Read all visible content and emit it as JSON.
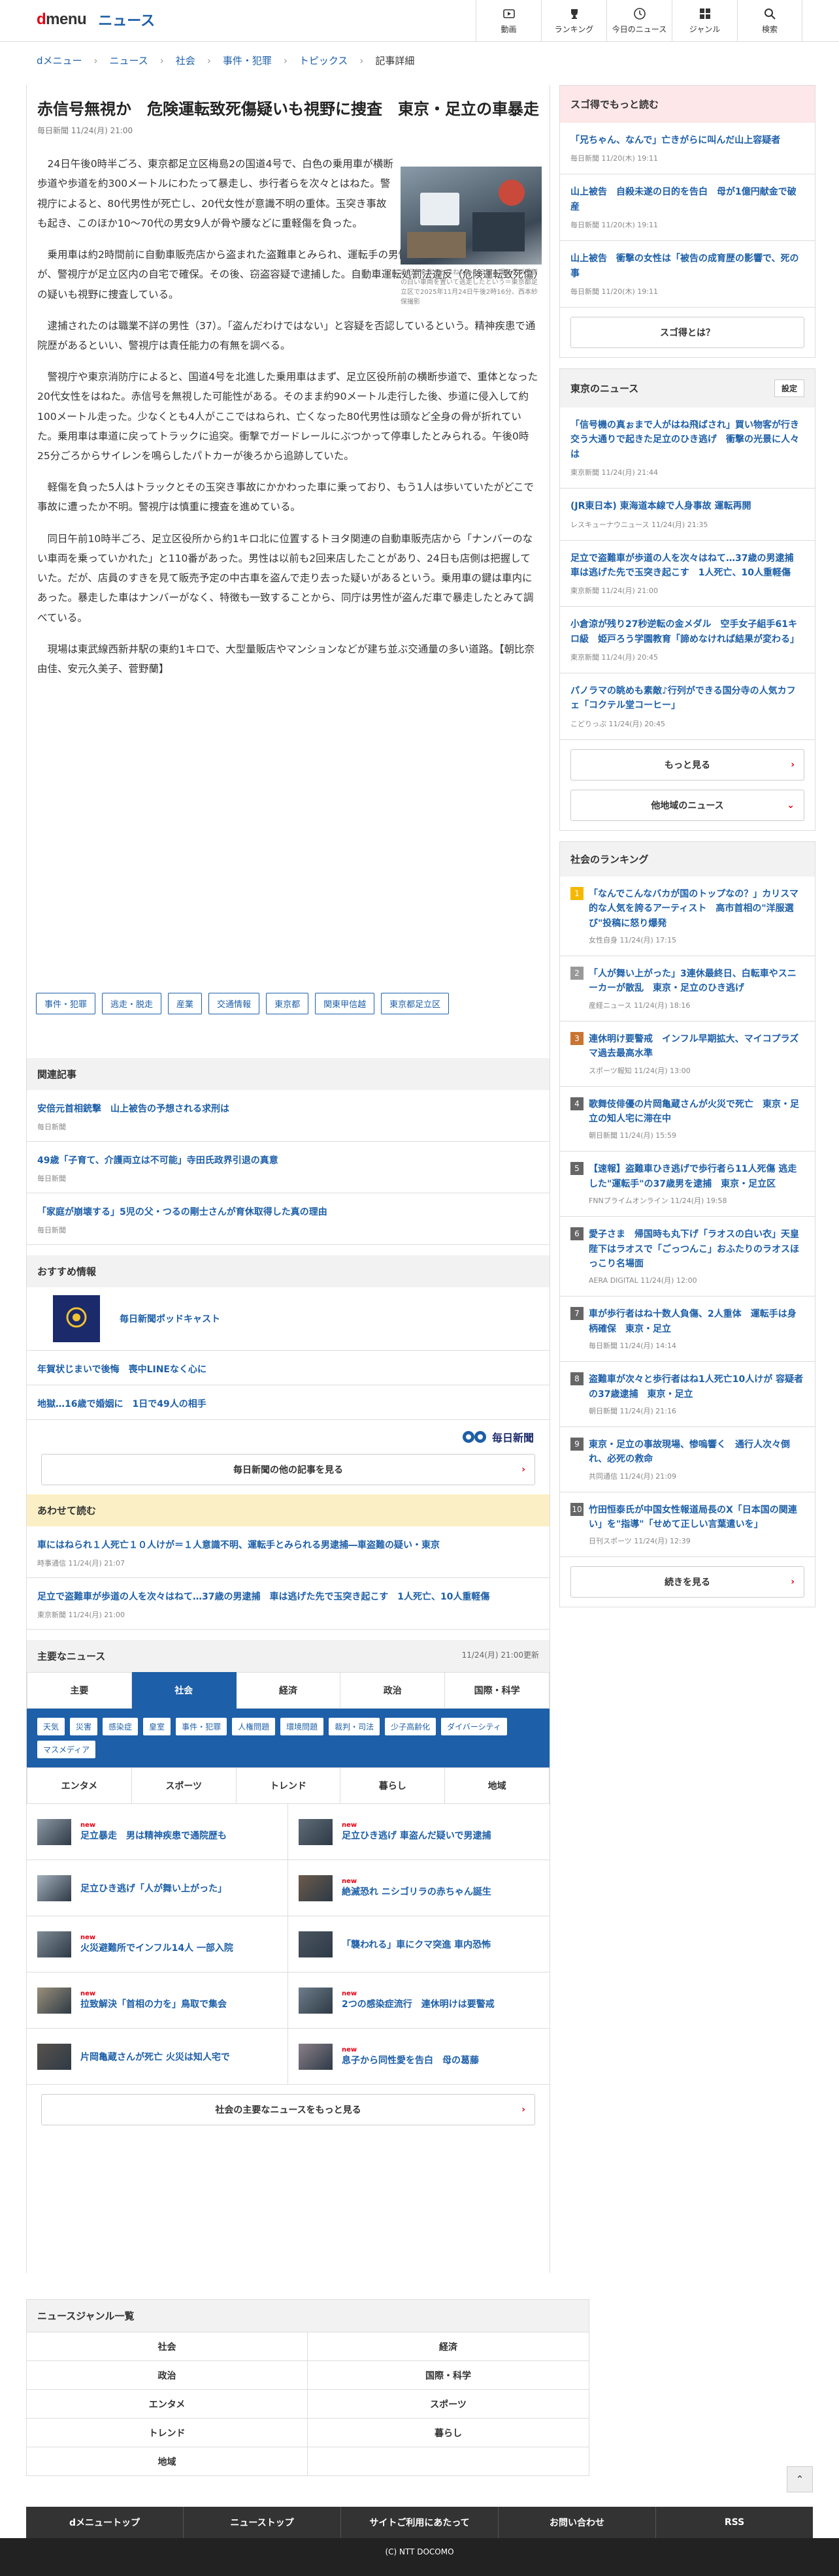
{
  "header": {
    "logo_d": "d",
    "logo_menu": "menu",
    "site": "ニュース",
    "nav": [
      "動画",
      "ランキング",
      "今日のニュース",
      "ジャンル",
      "検索"
    ]
  },
  "breadcrumb": [
    "dメニュー",
    "ニュース",
    "社会",
    "事件・犯罪",
    "トピックス",
    "記事詳細"
  ],
  "article": {
    "title": "赤信号無視か　危険運転致死傷疑いも視野に捜査　東京・足立の車暴走",
    "date": "毎日新聞 11/24(月) 21:00",
    "caption": "歩行者を次々とはねたとみられ、運転手が手前の白い車両を置いて逃走したという＝東京都足立区で2025年11月24日午後2時16分、西本紗保撮影",
    "paragraphs": [
      "24日午後0時半ごろ、東京都足立区梅島2の国道4号で、白色の乗用車が横断歩道や歩道を約300メートルにわたって暴走し、歩行者らを次々とはねた。警視庁によると、80代男性が死亡し、20代女性が意識不明の重体。玉突き事故も起き、このほか10～70代の男女9人が骨や腰などに重軽傷を負った。",
      "乗用車は約2時間前に自動車販売店から盗まれた盗難車とみられ、運転手の男性は徒歩で現場から逃走したが、警視庁が足立区内の自宅で確保。その後、窃盗容疑で逮捕した。自動車運転処罰法違反（危険運転致死傷）の疑いも視野に捜査している。",
      "逮捕されたのは職業不詳の男性（37）。「盗んだわけではない」と容疑を否認しているという。精神疾患で通院歴があるといい、警視庁は責任能力の有無を調べる。",
      "警視庁や東京消防庁によると、国道4号を北進した乗用車はまず、足立区役所前の横断歩道で、重体となった20代女性をはねた。赤信号を無視した可能性がある。そのまま約90メートル走行した後、歩道に侵入して約100メートル走った。少なくとも4人がここではねられ、亡くなった80代男性は頭など全身の骨が折れていた。乗用車は車道に戻ってトラックに追突。衝撃でガードレールにぶつかって停車したとみられる。午後0時25分ごろからサイレンを鳴らしたパトカーが後ろから追跡していた。",
      "軽傷を負った5人はトラックとその玉突き事故にかかわった車に乗っており、もう1人は歩いていたがどこで事故に遭ったか不明。警視庁は慎重に捜査を進めている。",
      "同日午前10時半ごろ、足立区役所から約1キロ北に位置するトヨタ関連の自動車販売店から「ナンバーのない車両を乗っていかれた」と110番があった。男性は以前も2回来店したことがあり、24日も店側は把握していた。だが、店員のすきを見て販売予定の中古車を盗んで走り去った疑いがあるという。乗用車の鍵は車内にあった。暴走した車はナンバーがなく、特徴も一致することから、同庁は男性が盗んだ車で暴走したとみて調べている。",
      "現場は東武線西新井駅の東約1キロで、大型量販店やマンションなどが建ち並ぶ交通量の多い道路。【朝比奈由佳、安元久美子、菅野蘭】"
    ],
    "tags": [
      "事件・犯罪",
      "逃走・脱走",
      "産業",
      "交通情報",
      "東京都",
      "関東甲信越",
      "東京都足立区"
    ]
  },
  "related": {
    "heading": "関連記事",
    "items": [
      {
        "title": "安倍元首相銃撃　山上被告の予想される求刑は",
        "src": "毎日新聞"
      },
      {
        "title": "49歳「子育て、介護両立は不可能」寺田氏政界引退の真意",
        "src": "毎日新聞"
      },
      {
        "title": "「家庭が崩壊する」5児の父・つるの剛士さんが育休取得した真の理由",
        "src": "毎日新聞"
      }
    ]
  },
  "recommend": {
    "heading": "おすすめ情報",
    "podcast": "毎日新聞ポッドキャスト",
    "items": [
      "年賀状じまいで後悔　喪中LINEなく心に",
      "地獄…16歳で婚姻に　1日で49人の相手"
    ],
    "brand": "毎日新聞",
    "more": "毎日新聞の他の記事を見る"
  },
  "also": {
    "heading": "あわせて読む",
    "items": [
      {
        "title": "車にはねられ１人死亡１０人けが＝１人意識不明、運転手とみられる男逮捕―車盗難の疑い・東京",
        "src": "時事通信 11/24(月) 21:07"
      },
      {
        "title": "足立で盗難車が歩道の人を次々はねて…37歳の男逮捕　車は逃げた先で玉突き起こす　1人死亡、10人重軽傷",
        "src": "東京新聞 11/24(月) 21:00"
      }
    ]
  },
  "major": {
    "heading": "主要なニュース",
    "updated": "11/24(月) 21:00更新",
    "tabs1": [
      "主要",
      "社会",
      "経済",
      "政治",
      "国際・科学"
    ],
    "chips": [
      "天気",
      "災害",
      "感染症",
      "皇室",
      "事件・犯罪",
      "人権問題",
      "環境問題",
      "裁判・司法",
      "少子高齢化",
      "ダイバーシティ",
      "マスメディア"
    ],
    "tabs2": [
      "エンタメ",
      "スポーツ",
      "トレンド",
      "暮らし",
      "地域"
    ],
    "new_label": "new",
    "items": [
      {
        "title": "足立暴走　男は精神疾患で通院歴も",
        "new": true
      },
      {
        "title": "足立ひき逃げ 車盗んだ疑いで男逮捕",
        "new": true
      },
      {
        "title": "足立ひき逃げ「人が舞い上がった」",
        "new": false
      },
      {
        "title": "絶滅恐れ ニシゴリラの赤ちゃん誕生",
        "new": true
      },
      {
        "title": "火災避難所でインフル14人 一部入院",
        "new": true
      },
      {
        "title": "「襲われる」車にクマ突進 車内恐怖",
        "new": false
      },
      {
        "title": "拉致解決「首相の力を」鳥取で集会",
        "new": true
      },
      {
        "title": "2つの感染症流行　連休明けは要警戒",
        "new": true
      },
      {
        "title": "片岡亀蔵さんが死亡 火災は知人宅で",
        "new": false
      },
      {
        "title": "息子から同性愛を告白　母の葛藤",
        "new": true
      }
    ],
    "more": "社会の主要なニュースをもっと見る"
  },
  "genre": {
    "heading": "ニュースジャンル一覧",
    "items": [
      "社会",
      "経済",
      "政治",
      "国際・科学",
      "エンタメ",
      "スポーツ",
      "トレンド",
      "暮らし",
      "地域",
      ""
    ]
  },
  "sugotoku": {
    "heading": "スゴ得でもっと読む",
    "items": [
      {
        "title": "「兄ちゃん、なんで」亡きがらに叫んだ山上容疑者",
        "src": "毎日新聞 11/20(木) 19:11"
      },
      {
        "title": "山上被告　自殺未遂の日的を告白　母が1億円献金で破産",
        "src": "毎日新聞 11/20(木) 19:11"
      },
      {
        "title": "山上被告　衝撃の女性は「被告の成育歴の影響で、死の事",
        "src": "毎日新聞 11/20(木) 19:11"
      }
    ],
    "what": "スゴ得とは？"
  },
  "tokyo": {
    "heading": "東京のニュース",
    "setting": "設定",
    "items": [
      {
        "title": "「信号機の真ぉまで人がはね飛ばされ」買い物客が行き交う大通りで起きた足立のひき逃げ　衝撃の光景に人々は",
        "src": "東京新聞 11/24(月) 21:44"
      },
      {
        "title": "(JR東日本) 東海道本線で人身事故 運転再開",
        "src": "レスキューナウニュース 11/24(月) 21:35"
      },
      {
        "title": "足立で盗難車が歩道の人を次々はねて…37歳の男逮捕　車は逃げた先で玉突き起こす　1人死亡、10人重軽傷",
        "src": "東京新聞 11/24(月) 21:00"
      },
      {
        "title": "小倉涼が残り27秒逆転の金メダル　空手女子組手61キロ級　姫戸ろう学園教育「諦めなければ結果が変わる」",
        "src": "東京新聞 11/24(月) 20:45"
      },
      {
        "title": "パノラマの眺めも素敵♪行列ができる国分寺の人気カフェ「コクテル堂コーヒー」",
        "src": "こどりっぷ 11/24(月) 20:45"
      }
    ],
    "more": "もっと見る",
    "region": "他地域のニュース"
  },
  "ranking": {
    "heading": "社会のランキング",
    "items": [
      {
        "title": "「なんでこんなバカが国のトップなの？」カリスマ的な人気を誇るアーティスト　高市首相の\"洋服選び\"投稿に怒り爆発",
        "src": "女性自身 11/24(月) 17:15"
      },
      {
        "title": "「人が舞い上がった」3連休最終日、白転車やスニーカーが散乱　東京・足立のひき逃げ",
        "src": "産経ニュース 11/24(月) 18:16"
      },
      {
        "title": "連休明け要警戒　インフル早期拡大、マイコプラズマ過去最高水準",
        "src": "スポーツ報知 11/24(月) 13:00"
      },
      {
        "title": "歌舞伎俳優の片岡亀蔵さんが火災で死亡　東京・足立の知人宅に滞在中",
        "src": "朝日新聞 11/24(月) 15:59"
      },
      {
        "title": "【速報】盗難車ひき逃げで歩行者ら11人死傷 逃走した\"運転手\"の37歳男を逮捕　東京・足立区",
        "src": "FNNプライムオンライン 11/24(月) 19:58"
      },
      {
        "title": "愛子さま　帰国時も丸下げ「ラオスの白い衣」天皇陛下はラオスで「ごっつんこ」おふたりのラオスほっこり名場面",
        "src": "AERA DIGITAL 11/24(月) 12:00"
      },
      {
        "title": "車が歩行者はね十数人負傷、2人重体　運転手は身柄確保　東京・足立",
        "src": "毎日新聞 11/24(月) 14:14"
      },
      {
        "title": "盗難車が次々と歩行者はね1人死亡10人けが 容疑者の37歳逮捕　東京・足立",
        "src": "朝日新聞 11/24(月) 21:16"
      },
      {
        "title": "東京・足立の事故現場、惨嗚響く　通行人次々倒れ、必死の救命",
        "src": "共同通信 11/24(月) 21:09"
      },
      {
        "title": "竹田恒泰氏が中国女性報道局長のX「日本国の関連い」を\"指導\"「せめて正しい言葉遣いを」",
        "src": "日刊スポーツ 11/24(月) 12:39"
      }
    ],
    "more": "続きを見る"
  },
  "footer": {
    "nav": [
      "dメニュートップ",
      "ニューストップ",
      "サイトご利用にあたって",
      "お問い合わせ",
      "RSS"
    ],
    "copyright": "(C) NTT DOCOMO"
  },
  "colors": {
    "accent": "#1d5fa8",
    "brand": "#e60012",
    "pink": "#fde7e9",
    "yellow": "#fbf0c5"
  }
}
